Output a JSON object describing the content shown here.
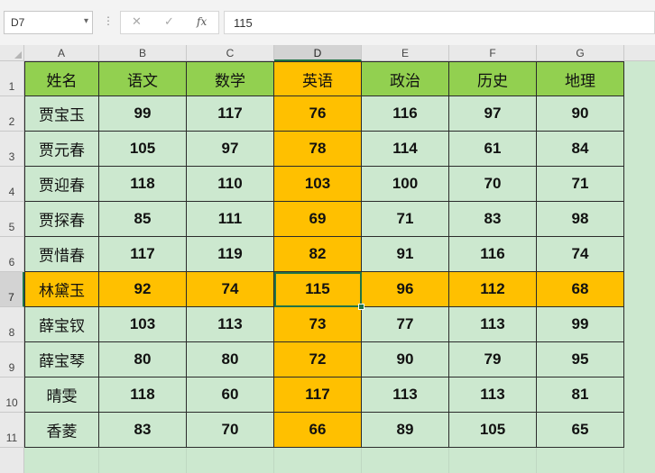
{
  "formula_bar": {
    "name_box": "D7",
    "name_box_dropdown": "▾",
    "separator": "⋮",
    "cancel_icon": "✕",
    "enter_icon": "✓",
    "fx_label": "fx",
    "formula": "115"
  },
  "columns": [
    "A",
    "B",
    "C",
    "D",
    "E",
    "F",
    "G"
  ],
  "rows": [
    "1",
    "2",
    "3",
    "4",
    "5",
    "6",
    "7",
    "8",
    "9",
    "10",
    "11"
  ],
  "selected_cell": {
    "column": "D",
    "row": "7"
  },
  "colors": {
    "header_fill": "#92d050",
    "body_fill": "#cce8cf",
    "highlight_fill": "#ffc000",
    "selection": "#217346"
  },
  "table": {
    "headers": [
      "姓名",
      "语文",
      "数学",
      "英语",
      "政治",
      "历史",
      "地理"
    ],
    "rows": [
      [
        "贾宝玉",
        "99",
        "117",
        "76",
        "116",
        "97",
        "90"
      ],
      [
        "贾元春",
        "105",
        "97",
        "78",
        "114",
        "61",
        "84"
      ],
      [
        "贾迎春",
        "118",
        "110",
        "103",
        "100",
        "70",
        "71"
      ],
      [
        "贾探春",
        "85",
        "111",
        "69",
        "71",
        "83",
        "98"
      ],
      [
        "贾惜春",
        "117",
        "119",
        "82",
        "91",
        "116",
        "74"
      ],
      [
        "林黛玉",
        "92",
        "74",
        "115",
        "96",
        "112",
        "68"
      ],
      [
        "薛宝钗",
        "103",
        "113",
        "73",
        "77",
        "113",
        "99"
      ],
      [
        "薛宝琴",
        "80",
        "80",
        "72",
        "90",
        "79",
        "95"
      ],
      [
        "晴雯",
        "118",
        "60",
        "117",
        "113",
        "113",
        "81"
      ],
      [
        "香菱",
        "83",
        "70",
        "66",
        "89",
        "105",
        "65"
      ]
    ]
  }
}
